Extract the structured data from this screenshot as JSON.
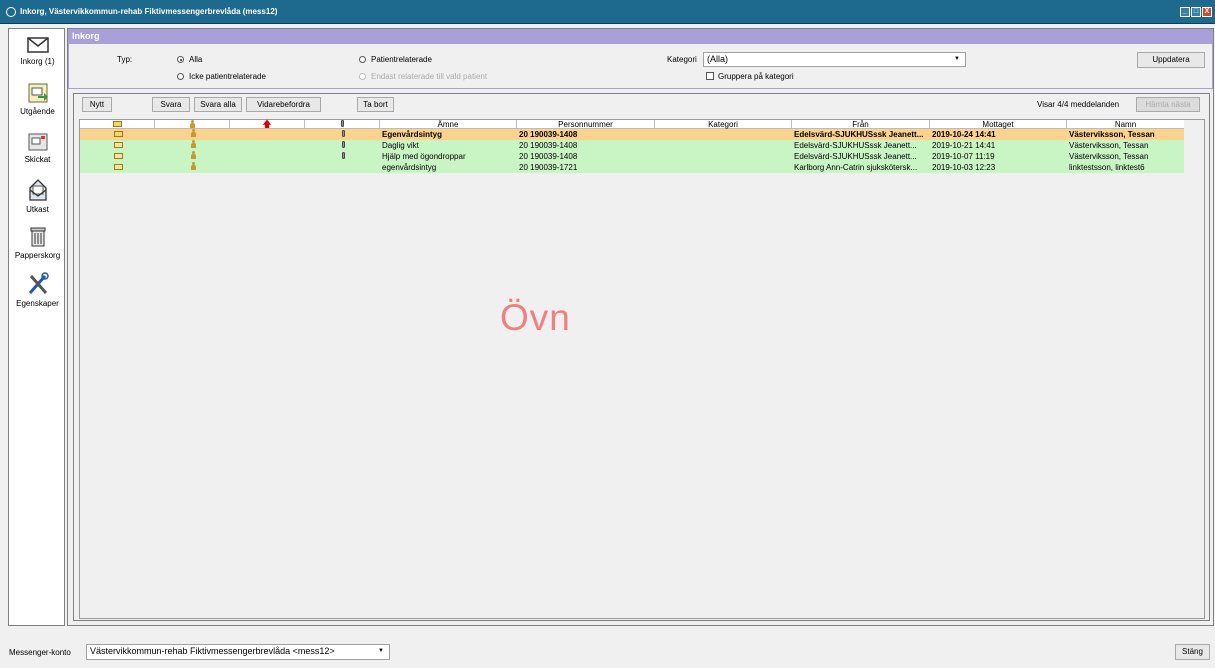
{
  "window": {
    "title": "Inkorg, Västervikkommun-rehab Fiktivmessengerbrevlåda (mess12)",
    "buttons": {
      "minimize": "_",
      "restore": "□",
      "close": "X"
    }
  },
  "sidebar": {
    "items": [
      {
        "label": "Inkorg (1)",
        "icon": "envelope-icon"
      },
      {
        "label": "Utgående",
        "icon": "outbox-icon"
      },
      {
        "label": "Skickat",
        "icon": "sent-icon"
      },
      {
        "label": "Utkast",
        "icon": "draft-icon"
      },
      {
        "label": "Papperskorg",
        "icon": "trash-icon"
      },
      {
        "label": "Egenskaper",
        "icon": "tools-icon"
      }
    ]
  },
  "header": {
    "title": "Inkorg"
  },
  "filter": {
    "typ_label": "Typ:",
    "radio_alla": "Alla",
    "radio_icke": "Icke patientrelaterade",
    "radio_patient": "Patientrelaterade",
    "radio_endast": "Endast relaterade till vald patient",
    "kategori_label": "Kategori",
    "kategori_value": "(Alla)",
    "gruppera_label": "Gruppera på kategori",
    "uppdatera_label": "Uppdatera"
  },
  "toolbar": {
    "nytt": "Nytt",
    "svara": "Svara",
    "svara_alla": "Svara alla",
    "vidarebefordra": "Vidarebefordra",
    "ta_bort": "Ta bort",
    "visar": "Visar 4/4 meddelanden",
    "hamta": "Hämta nästa"
  },
  "columns": {
    "amne": "Ämne",
    "personnummer": "Personnummer",
    "kategori": "Kategori",
    "fran": "Från",
    "mottaget": "Mottaget",
    "namn": "Namn"
  },
  "rows": [
    {
      "amne": "Egenvårdsintyg",
      "personnummer": "20 190039-1408",
      "kategori": "",
      "fran": "Edelsvärd-SJUKHUSssk Jeanett...",
      "mottaget": "2019-10-24 14:41",
      "namn": "Västerviksson, Tessan",
      "unread": true
    },
    {
      "amne": "Daglig vikt",
      "personnummer": "20 190039-1408",
      "kategori": "",
      "fran": "Edelsvärd-SJUKHUSssk Jeanett...",
      "mottaget": "2019-10-21 14:41",
      "namn": "Västerviksson, Tessan",
      "unread": false
    },
    {
      "amne": "Hjälp med ögondroppar",
      "personnummer": "20 190039-1408",
      "kategori": "",
      "fran": "Edelsvärd-SJUKHUSssk Jeanett...",
      "mottaget": "2019-10-07 11:19",
      "namn": "Västerviksson, Tessan",
      "unread": false
    },
    {
      "amne": "egenvårdsintyg",
      "personnummer": "20 190039-1721",
      "kategori": "",
      "fran": "Karlborg Ann-Catrin sjukskötersk...",
      "mottaget": "2019-10-03 12:23",
      "namn": "linktestsson, linktest6",
      "unread": false
    }
  ],
  "watermark": "Övn",
  "footer": {
    "konto_label": "Messenger-konto",
    "konto_value": "Västervikkommun-rehab Fiktivmessengerbrevlåda <mess12>",
    "stang": "Stäng"
  },
  "colors": {
    "titlebar": "#1e6a8e",
    "header": "#a9a0d9",
    "selected_row": "#fbd28e",
    "row": "#c9f4c4",
    "watermark": "#f08080"
  }
}
